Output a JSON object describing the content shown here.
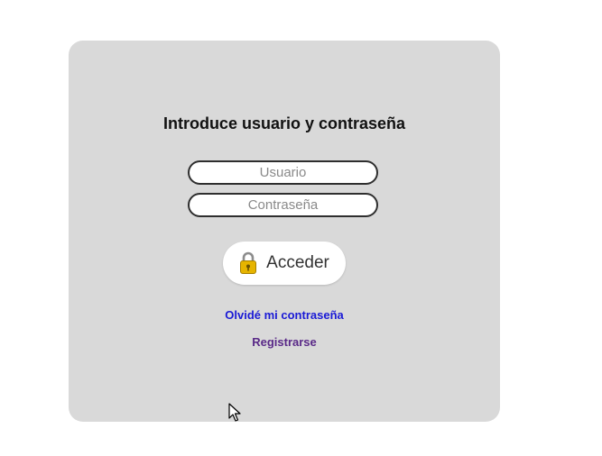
{
  "login": {
    "title": "Introduce usuario y contraseña",
    "username_placeholder": "Usuario",
    "password_placeholder": "Contraseña",
    "submit_label": "Acceder",
    "submit_icon": "lock-icon",
    "forgot_password_link": "Olvidé mi contraseña",
    "register_link": "Registrarse"
  },
  "colors": {
    "page_background": "#ffffff",
    "card_background": "#d9d9d9",
    "forgot_link": "#1a1ad6",
    "register_link": "#5a2a88",
    "lock_gold": "#e6b400"
  }
}
